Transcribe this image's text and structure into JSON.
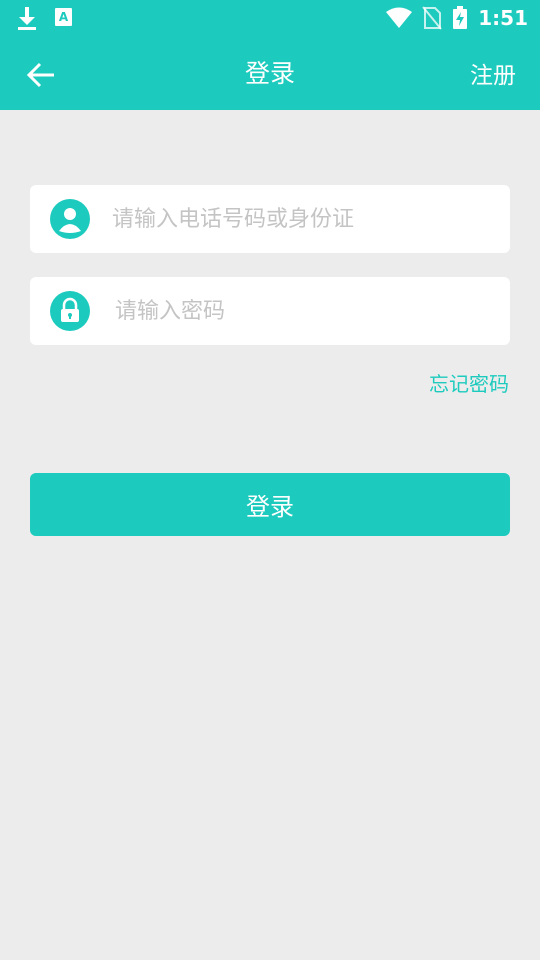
{
  "status_bar": {
    "time": "1:51",
    "icons": [
      "download-icon",
      "text-a-icon",
      "wifi-icon",
      "no-sim-icon",
      "battery-charging-icon"
    ]
  },
  "app_bar": {
    "title": "登录",
    "register_label": "注册"
  },
  "form": {
    "account_placeholder": "请输入电话号码或身份证",
    "password_placeholder": "请输入密码",
    "forgot_password_label": "忘记密码",
    "login_button_label": "登录"
  },
  "colors": {
    "primary": "#1dcbbe",
    "background": "#ececec",
    "placeholder": "#c4c4c4"
  }
}
